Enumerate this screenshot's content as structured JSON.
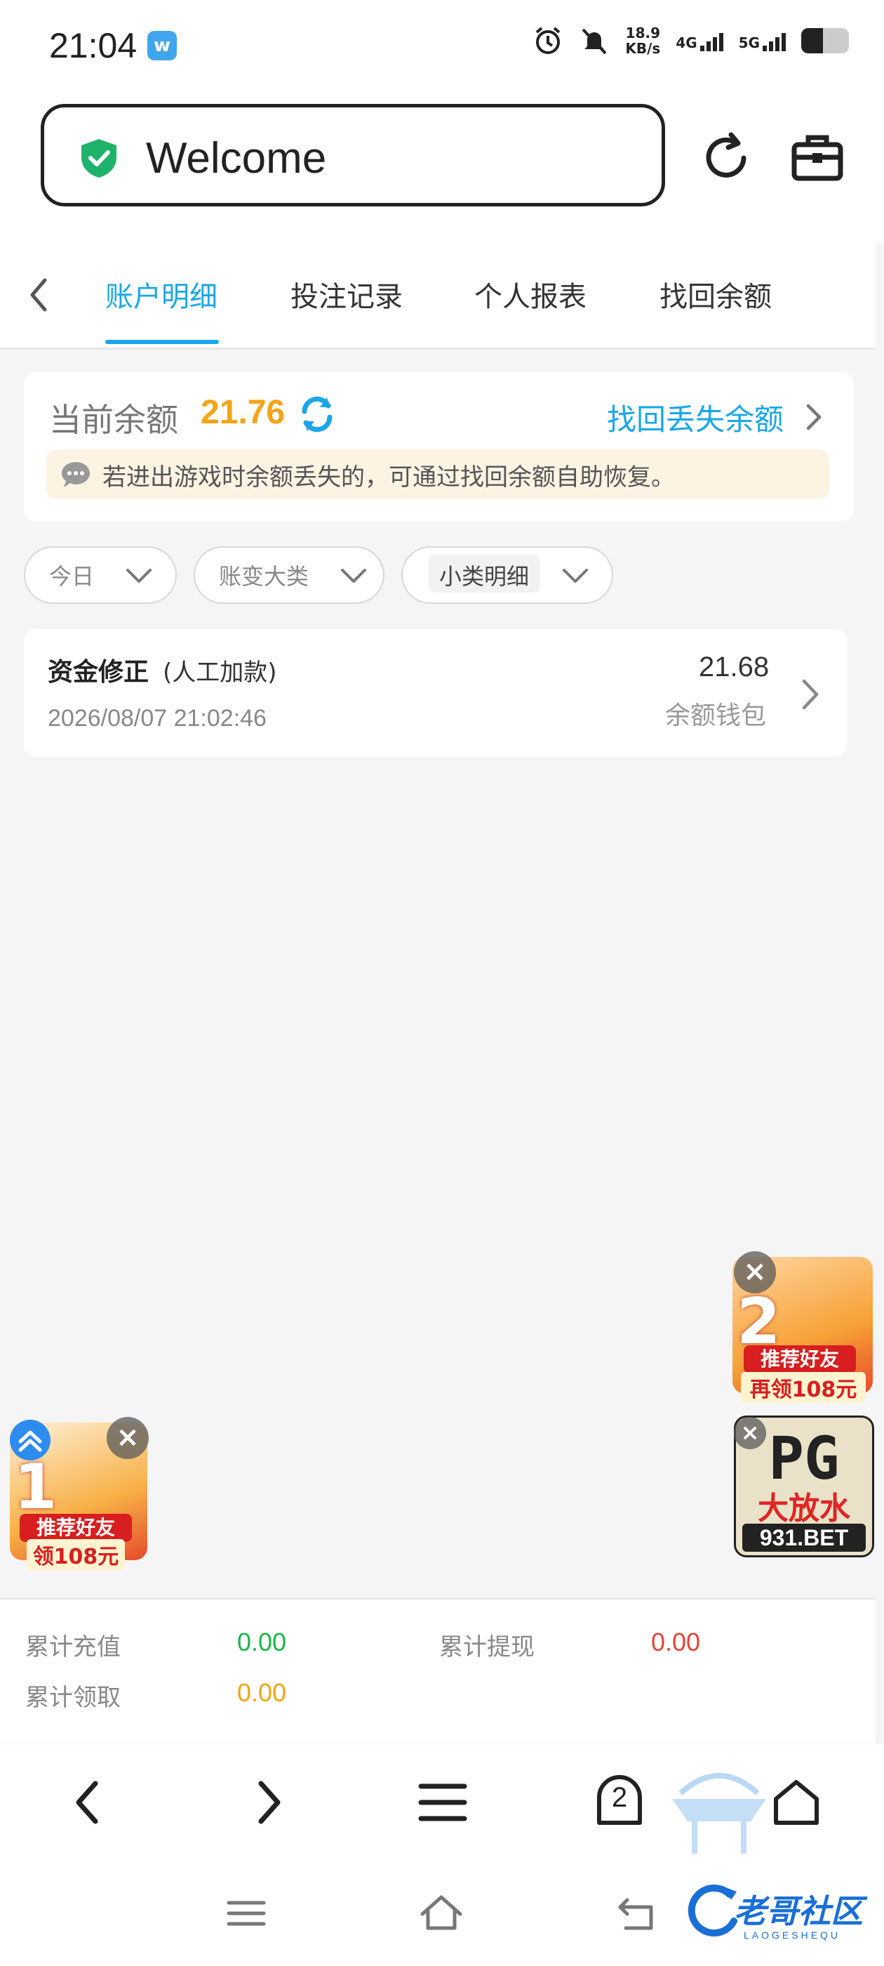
{
  "status_bar": {
    "time": "21:04",
    "app_badge": "w",
    "net_speed_value": "18.9",
    "net_speed_unit": "KB/s",
    "net_type_1": "4G",
    "net_type_2": "5G",
    "icons": [
      "alarm-icon",
      "mute-icon",
      "signal-icon",
      "battery-icon"
    ]
  },
  "url_bar": {
    "text": "Welcome",
    "secure_color": "#1fb26b"
  },
  "tabs": {
    "items": [
      {
        "label": "账户明细",
        "active": true
      },
      {
        "label": "投注记录",
        "active": false
      },
      {
        "label": "个人报表",
        "active": false
      },
      {
        "label": "找回余额",
        "active": false
      }
    ],
    "accent": "#1aa7e8"
  },
  "balance": {
    "label": "当前余额",
    "value": "21.76",
    "recover_link": "找回丢失余额",
    "notice": "若进出游戏时余额丢失的，可通过找回余额自助恢复。"
  },
  "filters": [
    {
      "label": "今日"
    },
    {
      "label": "账变大类"
    },
    {
      "label": "小类明细"
    }
  ],
  "records": [
    {
      "title": "资金修正",
      "subtitle": "(人工加款)",
      "time": "2026/08/07 21:02:46",
      "amount": "21.68",
      "wallet": "余额钱包"
    }
  ],
  "promos": {
    "left": {
      "badge": "1",
      "label": "推荐好友",
      "sub": "领108元"
    },
    "right_top": {
      "badge": "2",
      "label": "推荐好友",
      "sub": "再领108元"
    },
    "right_bottom": {
      "title": "PG",
      "label": "大放水",
      "sub": "931.BET"
    }
  },
  "summary": {
    "recharge_label": "累计充值",
    "recharge_value": "0.00",
    "withdraw_label": "累计提现",
    "withdraw_value": "0.00",
    "claim_label": "累计领取",
    "claim_value": "0.00"
  },
  "browser_nav": {
    "tab_count": "2"
  },
  "watermark": {
    "text": "老哥社区",
    "sub": "LAOGESHEQU"
  }
}
